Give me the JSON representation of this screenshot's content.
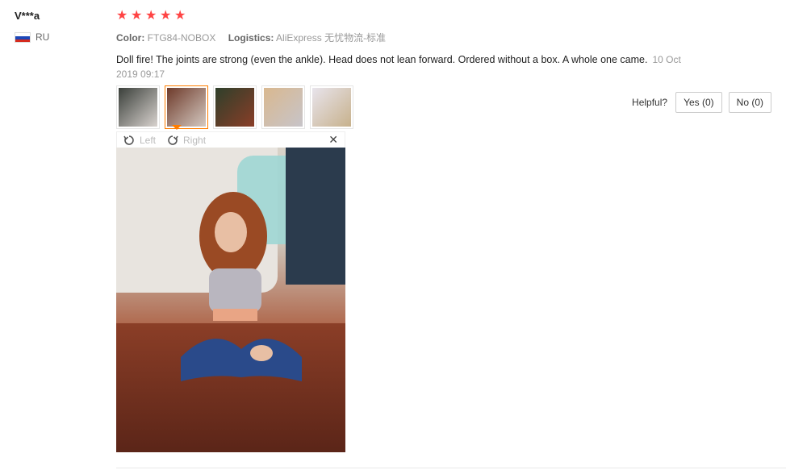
{
  "reviewer": {
    "name": "V***a",
    "country": "RU",
    "flag_colors": [
      "#ffffff",
      "#1c47b8",
      "#d52b1e"
    ]
  },
  "rating": {
    "stars": 5,
    "star_color": "#ff4444"
  },
  "meta": {
    "color_label": "Color:",
    "color_value": "FTG84-NOBOX",
    "logistics_label": "Logistics:",
    "logistics_value": "AliExpress 无忧物流-标准"
  },
  "content": {
    "text": "Doll fire! The joints are strong (even the ankle). Head does not lean forward. Ordered without a box. A whole one came.",
    "date": "10 Oct 2019 09:17"
  },
  "thumbnails": [
    {
      "name": "photo-1",
      "active": false,
      "colors": [
        "#3a3f3a",
        "#d9d3cf"
      ]
    },
    {
      "name": "photo-2",
      "active": true,
      "colors": [
        "#6e3a2a",
        "#d4c9c1"
      ]
    },
    {
      "name": "photo-3",
      "active": false,
      "colors": [
        "#2e3f2a",
        "#8a3e28"
      ]
    },
    {
      "name": "photo-4",
      "active": false,
      "colors": [
        "#d9b88f",
        "#c7c4c9"
      ]
    },
    {
      "name": "photo-5",
      "active": false,
      "colors": [
        "#e8e4ec",
        "#c7b18c"
      ]
    }
  ],
  "viewer": {
    "rotate_left": "Left",
    "rotate_right": "Right",
    "close": "✕"
  },
  "helpful": {
    "label": "Helpful?",
    "yes": "Yes (0)",
    "no": "No (0)"
  },
  "accent_color": "#ff7d00"
}
